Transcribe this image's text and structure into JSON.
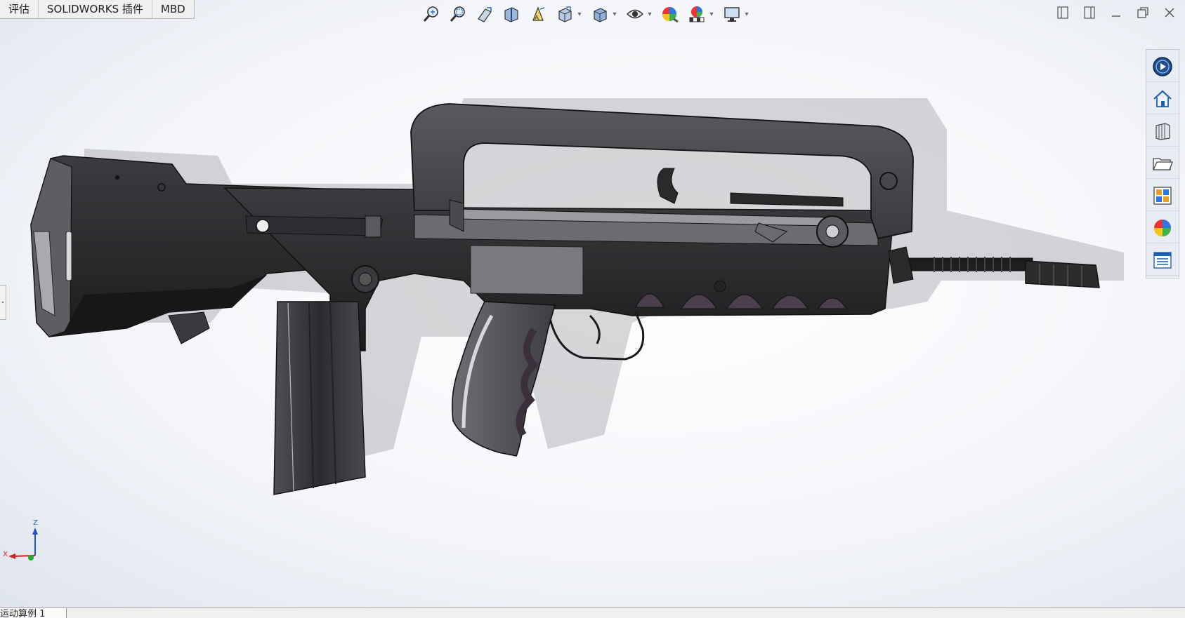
{
  "command_tabs": [
    "评估",
    "SOLIDWORKS 插件",
    "MBD"
  ],
  "hud_toolbar": {
    "icons": [
      {
        "name": "zoom-to-fit-icon"
      },
      {
        "name": "zoom-to-area-icon"
      },
      {
        "name": "previous-view-icon"
      },
      {
        "name": "section-view-icon"
      },
      {
        "name": "dynamic-annotation-views-icon"
      },
      {
        "name": "view-orientation-icon",
        "dropdown": true
      },
      {
        "name": "display-style-icon",
        "dropdown": true
      },
      {
        "name": "hide-show-items-icon",
        "dropdown": true
      },
      {
        "name": "edit-appearance-icon"
      },
      {
        "name": "apply-scene-icon",
        "dropdown": true
      },
      {
        "name": "view-settings-icon",
        "dropdown": true
      }
    ]
  },
  "window_controls": [
    "tile-left-icon",
    "tile-right-icon",
    "minimize-icon",
    "restore-icon",
    "close-icon"
  ],
  "task_pane": [
    {
      "name": "solidworks-resources-icon"
    },
    {
      "name": "home-icon"
    },
    {
      "name": "design-library-icon"
    },
    {
      "name": "file-explorer-icon"
    },
    {
      "name": "view-palette-icon"
    },
    {
      "name": "appearances-scenes-icon"
    },
    {
      "name": "custom-properties-icon"
    }
  ],
  "triad": {
    "z_label": "Z",
    "x_label": "X"
  },
  "bottom_tab": "运动算例 1",
  "colors": {
    "body_dark": "#2a2a2c",
    "body_mid": "#4a4a4e",
    "body_light": "#8a8a90",
    "accent_purple": "#5a4a5c",
    "ghost": "#b9b9be",
    "triad_z": "#2255cc",
    "triad_x": "#cc2222",
    "triad_y": "#22aa33"
  }
}
